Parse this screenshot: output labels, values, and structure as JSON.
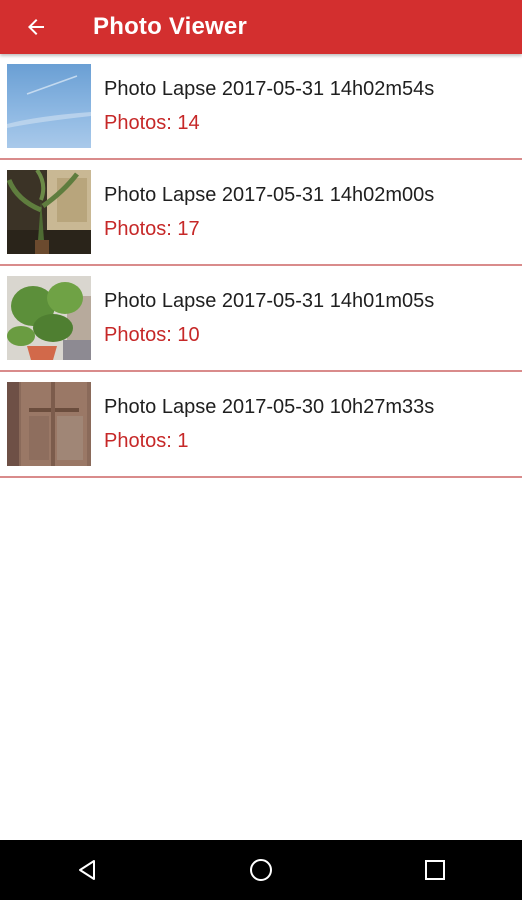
{
  "app_bar": {
    "title": "Photo Viewer",
    "background": "#d32f2f",
    "back_icon": "arrow-back-icon"
  },
  "lapses": [
    {
      "title": "Photo Lapse 2017-05-31 14h02m54s",
      "count": "Photos: 14",
      "thumbnail": "sky"
    },
    {
      "title": "Photo Lapse 2017-05-31 14h02m00s",
      "count": "Photos: 17",
      "thumbnail": "cactus-window"
    },
    {
      "title": "Photo Lapse 2017-05-31 14h01m05s",
      "count": "Photos: 10",
      "thumbnail": "potted-plant"
    },
    {
      "title": "Photo Lapse 2017-05-30 10h27m33s",
      "count": "Photos: 1",
      "thumbnail": "wooden-door"
    }
  ],
  "nav_bar": {
    "back_icon": "triangle-back-icon",
    "home_icon": "circle-home-icon",
    "recents_icon": "square-recents-icon"
  }
}
